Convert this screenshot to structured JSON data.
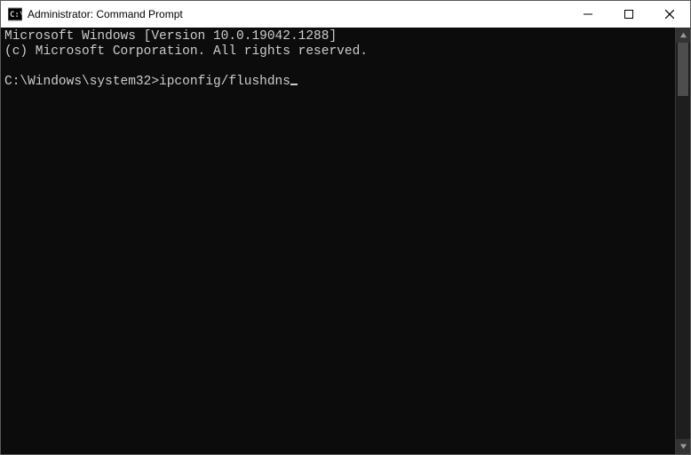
{
  "window": {
    "title": "Administrator: Command Prompt"
  },
  "terminal": {
    "line1": "Microsoft Windows [Version 10.0.19042.1288]",
    "line2": "(c) Microsoft Corporation. All rights reserved.",
    "blank": "",
    "prompt": "C:\\Windows\\system32>",
    "command": "ipconfig/flushdns"
  }
}
